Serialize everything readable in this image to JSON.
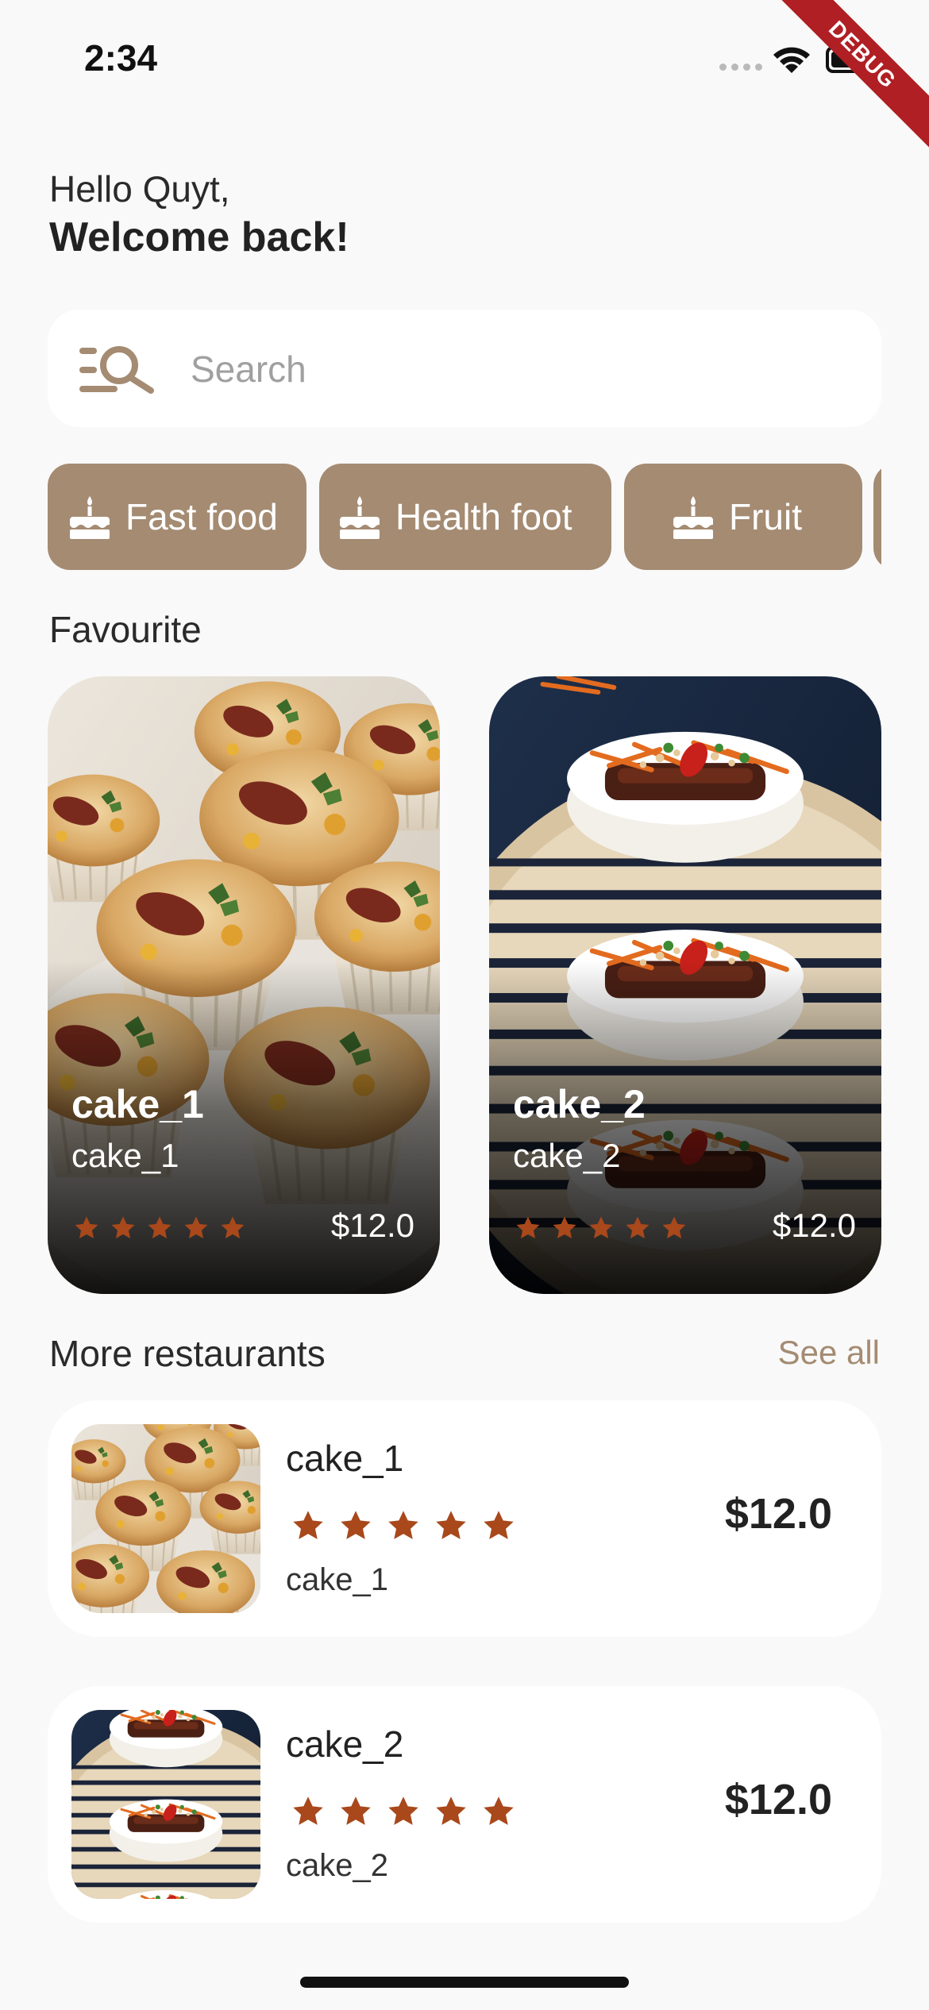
{
  "status_bar": {
    "time": "2:34"
  },
  "debug_banner": "DEBUG",
  "greeting": {
    "hello": "Hello Quyt,",
    "welcome": "Welcome back!"
  },
  "search": {
    "placeholder": "Search",
    "icon": "search-filter-icon"
  },
  "categories": [
    {
      "label": "Fast food",
      "icon": "cake-icon"
    },
    {
      "label": "Health foot",
      "icon": "cake-icon"
    },
    {
      "label": "Fruit",
      "icon": "cake-icon"
    }
  ],
  "favourite": {
    "title": "Favourite",
    "items": [
      {
        "name": "cake_1",
        "subtitle": "cake_1",
        "rating": 5,
        "price": "$12.0",
        "image": "muffins-photo"
      },
      {
        "name": "cake_2",
        "subtitle": "cake_2",
        "rating": 5,
        "price": "$12.0",
        "image": "bao-buns-photo"
      }
    ]
  },
  "more_restaurants": {
    "title": "More restaurants",
    "see_all": "See all",
    "items": [
      {
        "name": "cake_1",
        "subtitle": "cake_1",
        "rating": 5,
        "price": "$12.0",
        "image": "muffins-photo"
      },
      {
        "name": "cake_2",
        "subtitle": "cake_2",
        "rating": 5,
        "price": "$12.0",
        "image": "bao-buns-photo"
      }
    ]
  },
  "colors": {
    "background": "#f9f9f9",
    "accent": "#a48b72",
    "star": "#a8481b",
    "card": "#ffffff",
    "debug": "#b01f24"
  }
}
